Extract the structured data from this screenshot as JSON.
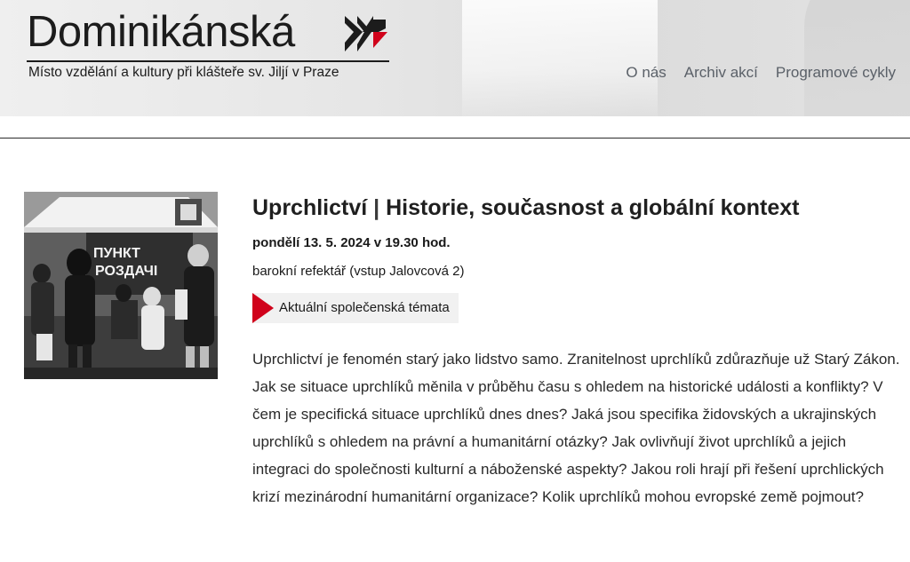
{
  "header": {
    "logo_title": "Dominikánská",
    "logo_subtitle": "Místo vzdělání a kultury při klášteře sv. Jiljí v Praze",
    "nav": [
      {
        "label": "O nás"
      },
      {
        "label": "Archiv akcí"
      },
      {
        "label": "Programové cykly"
      }
    ]
  },
  "event": {
    "title_strong": "Uprchlictví",
    "title_separator": "|",
    "title_rest": "Historie, současnost a globální kontext",
    "date": "pondělí 13. 5. 2024 v 19.30 hod.",
    "venue": "barokní refektář (vstup Jalovcová 2)",
    "tag": "Aktuální společenská témata",
    "description": "Uprchlictví je fenomén starý jako lidstvo samo. Zranitelnost uprchlíků zdůrazňuje už Starý Zákon. Jak se situace uprchlíků měnila v průběhu času s ohledem na historické události a konflikty? V čem je specifická situace uprchlíků dnes dnes? Jaká jsou specifika židovských a ukrajinských uprchlíků s ohledem na právní a humanitární otázky? Jak ovlivňují život uprchlíků a jejich integraci do společnosti kulturní a náboženské aspekty? Jakou roli hrají při řešení uprchlických krizí mezinárodní humanitární organizace? Kolik uprchlíků mohou evropské země pojmout?",
    "photo_sign_line1": "ПУНКТ",
    "photo_sign_line2": "РОЗДАЧІ"
  },
  "colors": {
    "accent_red": "#d0021b",
    "nav_text": "#5a6068",
    "tag_bg": "#f1f1f1"
  },
  "icons": {
    "logo_mark": "dominican-cross-icon",
    "tag_marker": "red-flag-icon"
  }
}
